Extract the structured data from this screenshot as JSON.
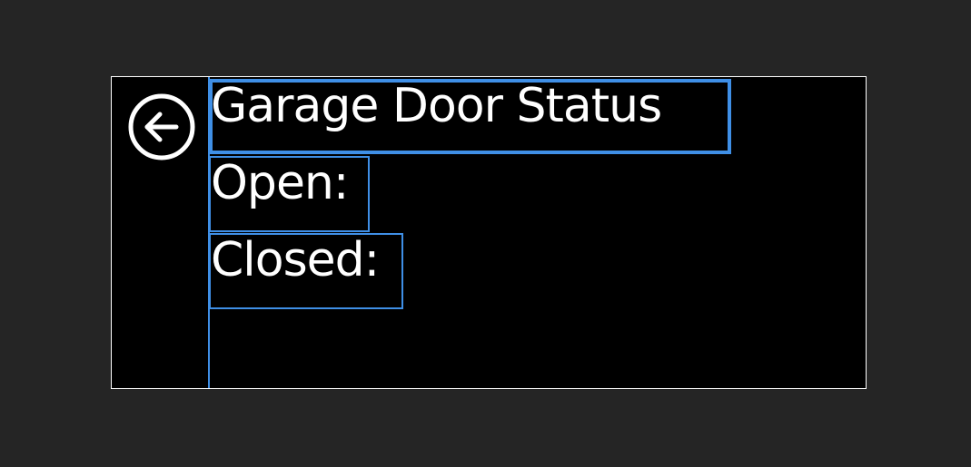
{
  "page": {
    "title": "Garage Door Status",
    "status_open_label": "Open:",
    "status_closed_label": "Closed:"
  },
  "icons": {
    "back": "back-arrow-circle-icon"
  },
  "colors": {
    "background": "#252525",
    "canvas": "#000000",
    "text": "#ffffff",
    "selection_outline": "#3f8fe6"
  }
}
